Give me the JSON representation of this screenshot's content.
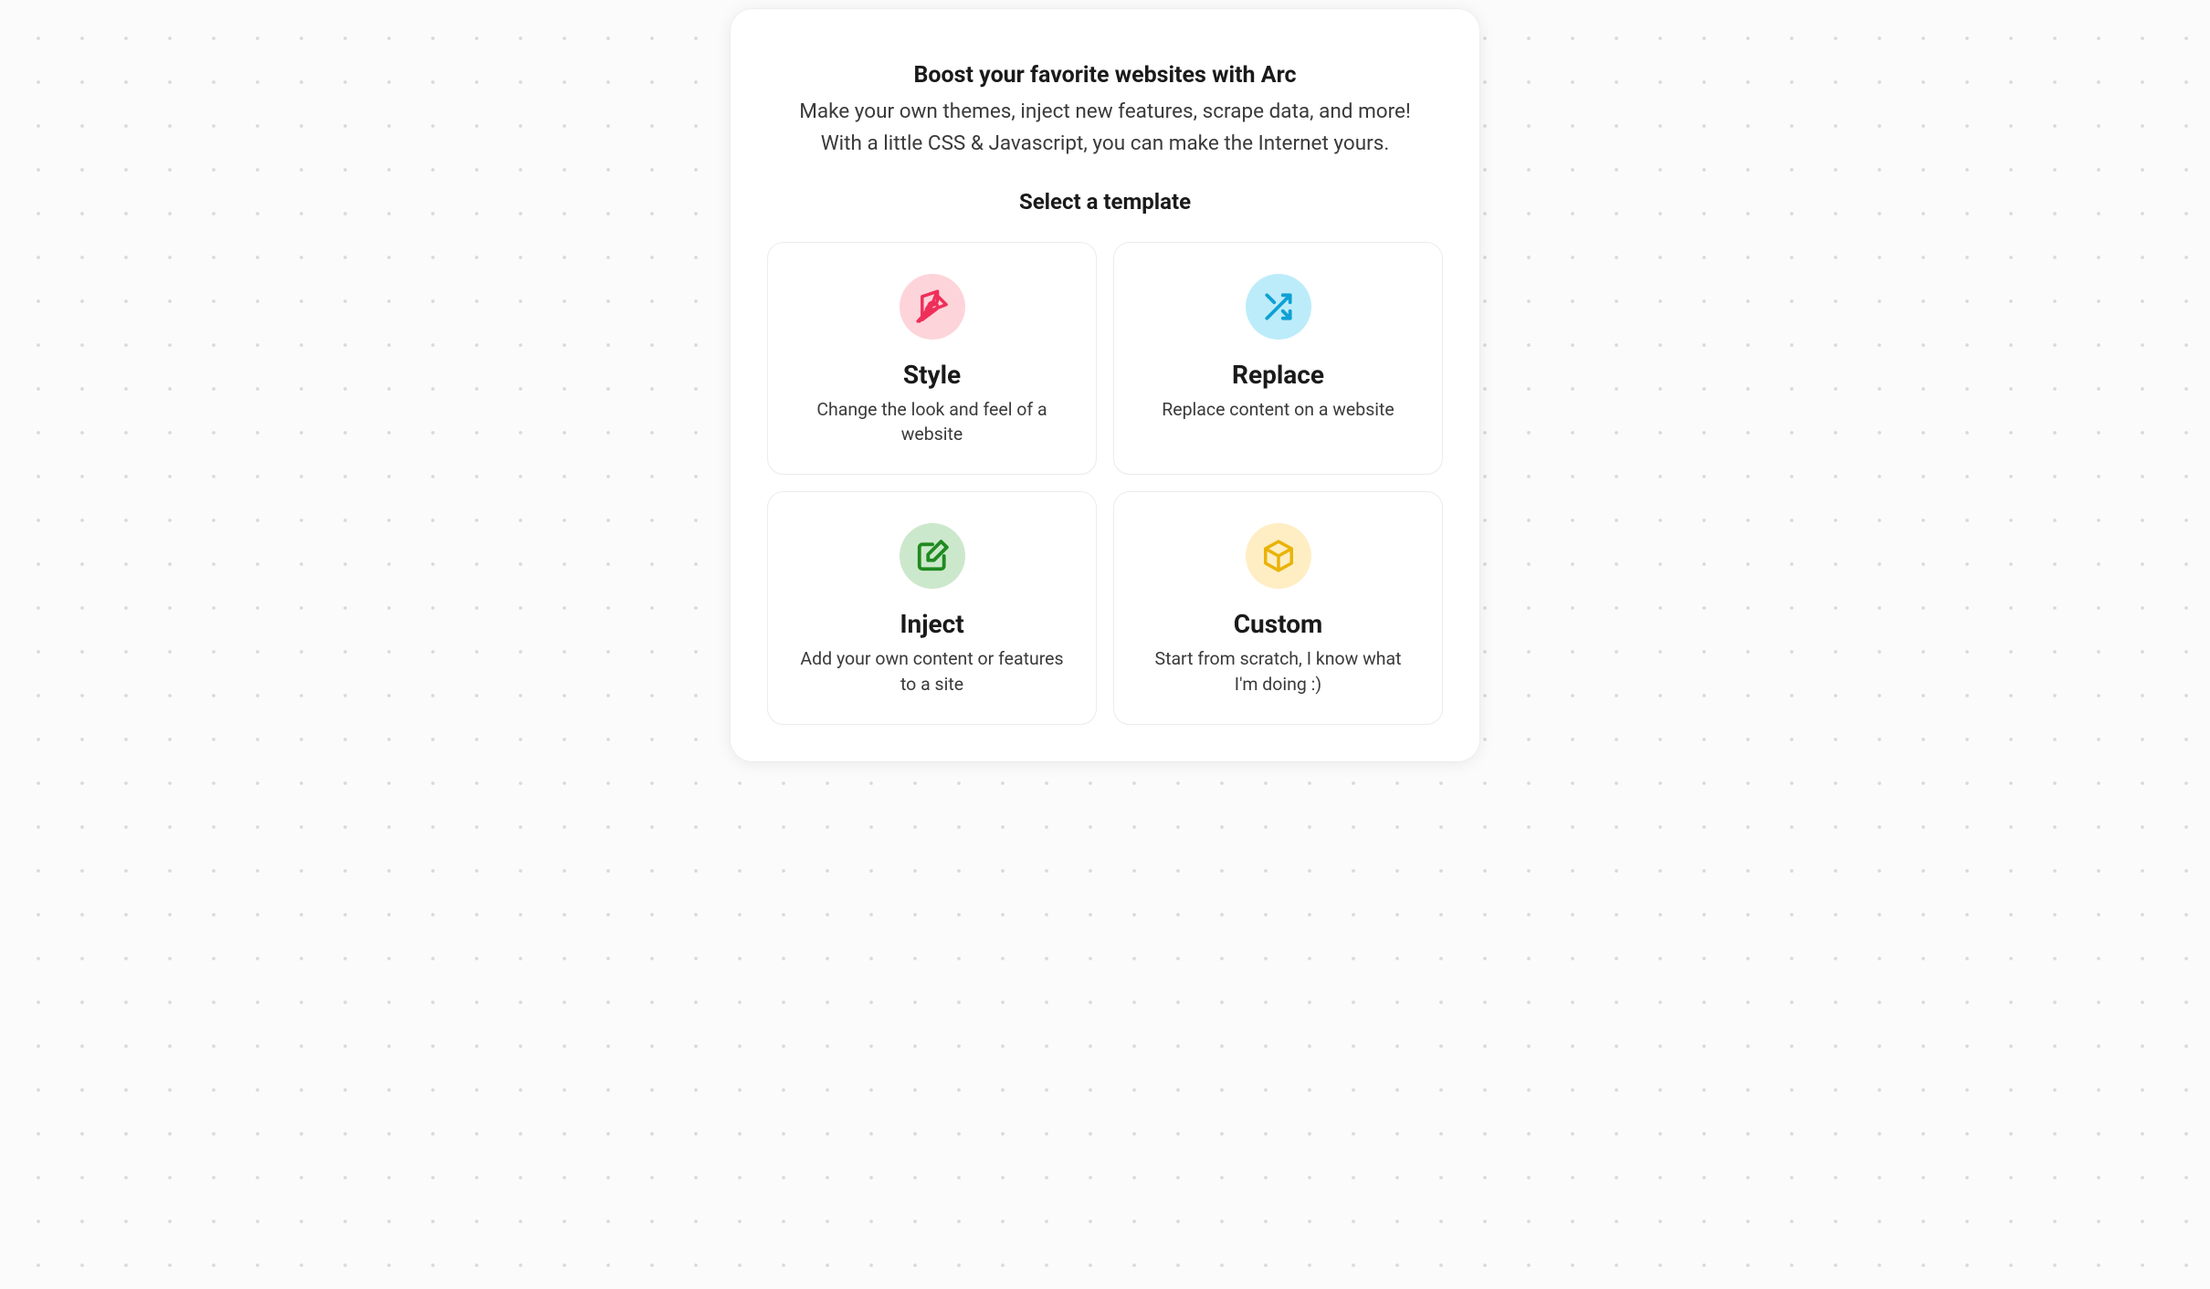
{
  "header": {
    "title": "Boost your favorite websites with Arc",
    "subtitle_line1": "Make your own themes, inject new features, scrape data, and more!",
    "subtitle_line2": "With a little CSS & Javascript, you can make the Internet yours."
  },
  "section_title": "Select a template",
  "templates": [
    {
      "icon": "pen-icon",
      "title": "Style",
      "description": "Change the look and feel of a website"
    },
    {
      "icon": "shuffle-icon",
      "title": "Replace",
      "description": "Replace content on a website"
    },
    {
      "icon": "edit-icon",
      "title": "Inject",
      "description": "Add your own content or features to a site"
    },
    {
      "icon": "cube-icon",
      "title": "Custom",
      "description": "Start from scratch, I know what I'm doing :)"
    }
  ]
}
